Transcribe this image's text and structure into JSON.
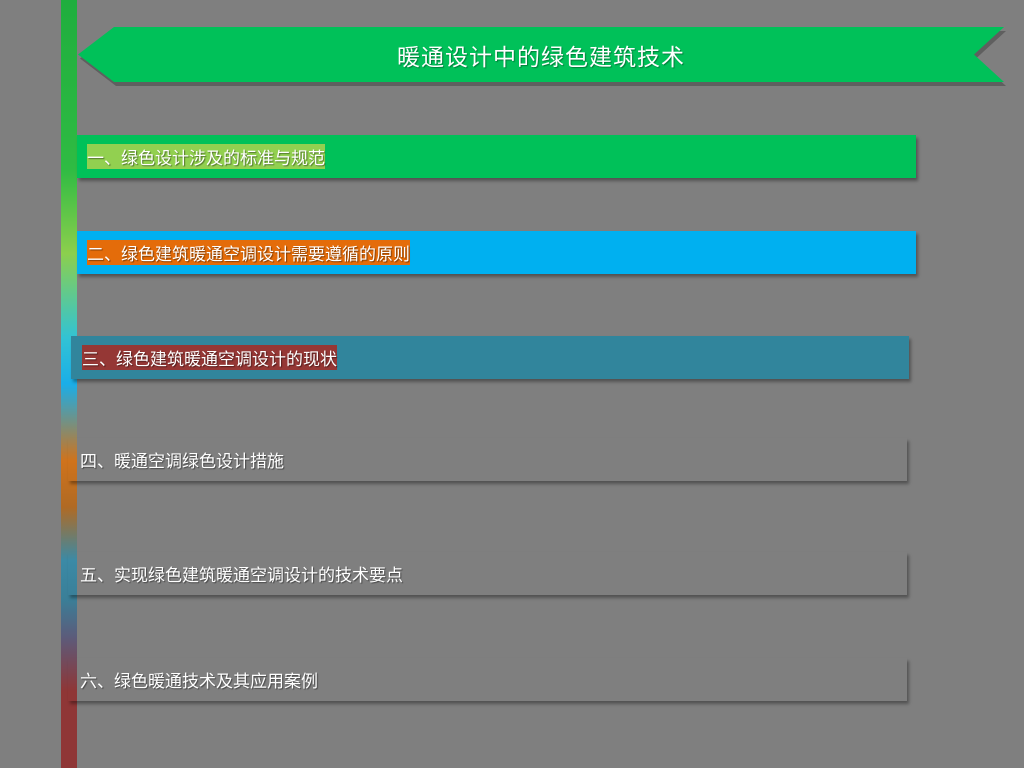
{
  "title": "暖通设计中的绿色建筑技术",
  "items": [
    {
      "label": "一、绿色设计涉及的标准与规范",
      "color": "#00c159"
    },
    {
      "label": "二、绿色建筑暖通空调设计需要遵循的原则",
      "color": "#92d050"
    },
    {
      "label": "三、绿色建筑暖通空调设计的现状",
      "color": "#00b0f0"
    },
    {
      "label": "四、暖通空调绿色设计措施",
      "color": "#e46c0a"
    },
    {
      "label": "五、实现绿色建筑暖通空调设计的技术要点",
      "color": "#31859c"
    },
    {
      "label": "六、绿色暖通技术及其应用案例",
      "color": "#953735"
    }
  ]
}
